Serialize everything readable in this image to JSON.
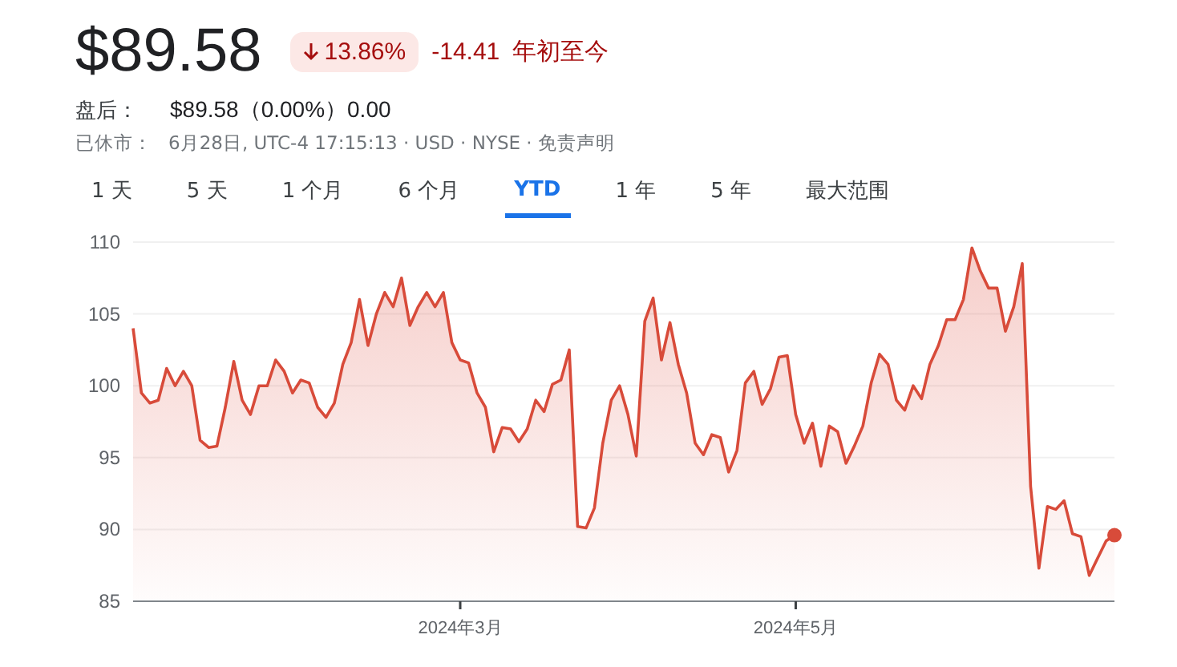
{
  "quote": {
    "price": "$89.58",
    "negative": true,
    "change_percent": "13.86%",
    "change": "-14.41",
    "period": "年初至今"
  },
  "after_hours": {
    "label": "盘后：",
    "value": "$89.58（0.00%）0.00"
  },
  "status": {
    "label": "已休市：",
    "text": "6月28日, UTC-4 17:15:13 · USD · NYSE · 免责声明"
  },
  "ranges": [
    {
      "label": "1 天",
      "selected": false
    },
    {
      "label": "5 天",
      "selected": false
    },
    {
      "label": "1 个月",
      "selected": false
    },
    {
      "label": "6 个月",
      "selected": false
    },
    {
      "label": "YTD",
      "selected": true
    },
    {
      "label": "1 年",
      "selected": false
    },
    {
      "label": "5 年",
      "selected": false
    },
    {
      "label": "最大范围",
      "selected": false
    }
  ],
  "chart": {
    "chart_data": {
      "type": "area",
      "categories": [
        null,
        null,
        null,
        null,
        null,
        null,
        null,
        null,
        null,
        null,
        null,
        null,
        null,
        null,
        null,
        null,
        null,
        null,
        null,
        null,
        null,
        null,
        null,
        null,
        null,
        null,
        null,
        null,
        null,
        null,
        null,
        null,
        null,
        null,
        null,
        null,
        null,
        null,
        null,
        "2024年3月",
        null,
        null,
        null,
        null,
        null,
        null,
        null,
        null,
        null,
        null,
        null,
        null,
        null,
        null,
        null,
        null,
        null,
        null,
        null,
        null,
        null,
        null,
        null,
        null,
        null,
        null,
        null,
        null,
        null,
        null,
        null,
        null,
        null,
        null,
        null,
        null,
        null,
        null,
        null,
        "2024年5月",
        null,
        null,
        null,
        null,
        null,
        null,
        null,
        null,
        null,
        null,
        null,
        null,
        null,
        null,
        null,
        null,
        null,
        null,
        null,
        null,
        null,
        null,
        null,
        null,
        null,
        null,
        null,
        null,
        null,
        null,
        null,
        null,
        null,
        null,
        null,
        null,
        null,
        null
      ],
      "series": [
        {
          "color": "#d84b3a",
          "values": [
            104,
            99.5,
            98.8,
            99,
            101.2,
            100,
            101,
            100,
            96.2,
            95.7,
            95.8,
            98.5,
            101.7,
            99,
            98,
            100,
            100,
            101.8,
            101,
            99.5,
            100.4,
            100.2,
            98.5,
            97.8,
            98.8,
            101.5,
            103,
            106,
            102.8,
            105,
            106.5,
            105.5,
            107.5,
            104.2,
            105.5,
            106.5,
            105.5,
            106.5,
            103,
            101.8,
            101.6,
            99.5,
            98.5,
            95.4,
            97.1,
            97,
            96.1,
            97,
            99,
            98.2,
            100.1,
            100.4,
            102.5,
            90.2,
            90.1,
            91.5,
            96,
            99,
            100,
            98,
            95.1,
            104.5,
            106.1,
            101.8,
            104.4,
            101.5,
            99.5,
            96,
            95.2,
            96.6,
            96.4,
            94,
            95.5,
            100.2,
            101,
            98.7,
            99.8,
            102,
            102.1,
            98,
            96,
            97.4,
            94.4,
            97.2,
            96.8,
            94.6,
            95.8,
            97.2,
            100.2,
            102.2,
            101.5,
            99,
            98.3,
            100,
            99.1,
            101.5,
            102.8,
            104.6,
            104.6,
            106,
            109.6,
            108,
            106.8,
            106.8,
            103.8,
            105.5,
            108.5,
            93,
            87.3,
            91.6,
            91.4,
            92,
            89.7,
            89.5,
            86.8,
            88,
            89.2,
            89.6
          ]
        }
      ],
      "ylim": [
        85,
        110
      ],
      "grid": true,
      "yticks": [
        85,
        90,
        95,
        100,
        105,
        110
      ]
    }
  }
}
